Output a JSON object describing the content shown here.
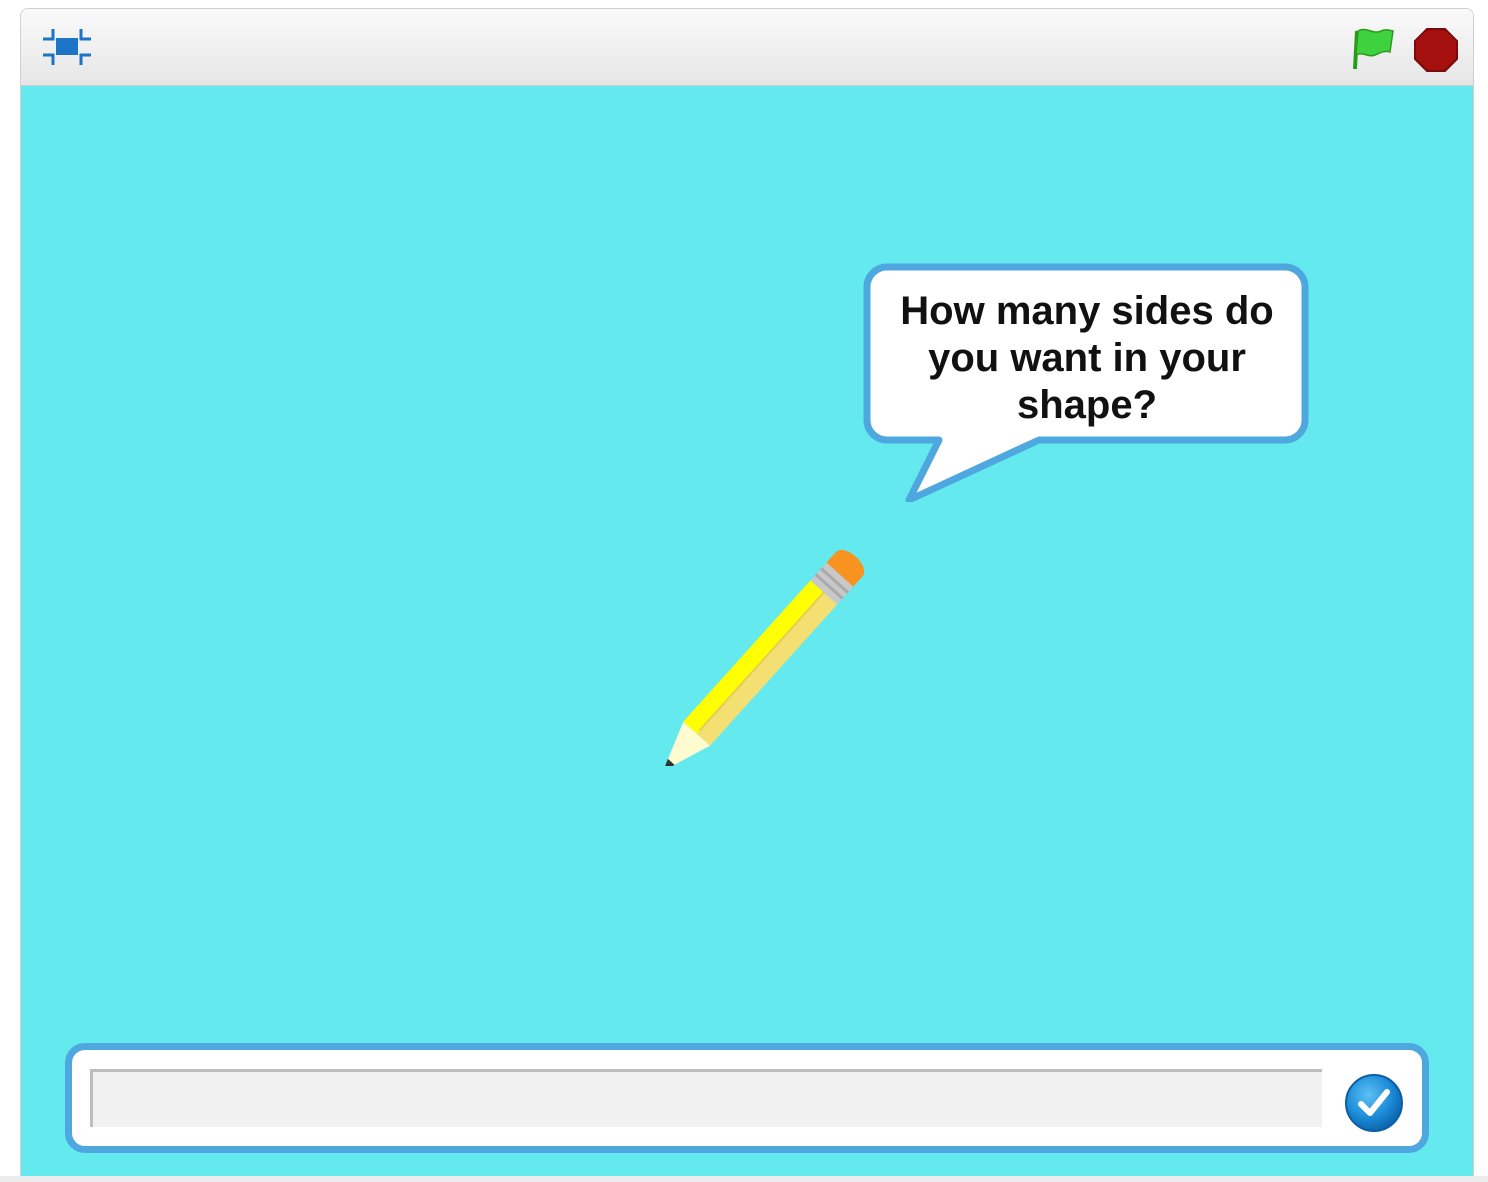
{
  "controls": {
    "fullscreen_icon": "fullscreen-icon",
    "green_flag_icon": "green-flag-icon",
    "stop_icon": "stop-icon"
  },
  "stage": {
    "background_color": "#63e9ee",
    "sprite": "pencil",
    "speech_bubble": {
      "text": "How many sides do you want in your shape?",
      "lines": [
        "How many sides do",
        "you want in your",
        "shape?"
      ]
    }
  },
  "ask_prompt": {
    "input_value": "",
    "input_placeholder": "",
    "submit_icon": "checkmark-icon"
  },
  "colors": {
    "accent_blue": "#4ea8df",
    "flag_green": "#3ed33e",
    "stop_red": "#a3100e",
    "pencil_yellow": "#ffff00",
    "eraser_orange": "#f7931e"
  }
}
